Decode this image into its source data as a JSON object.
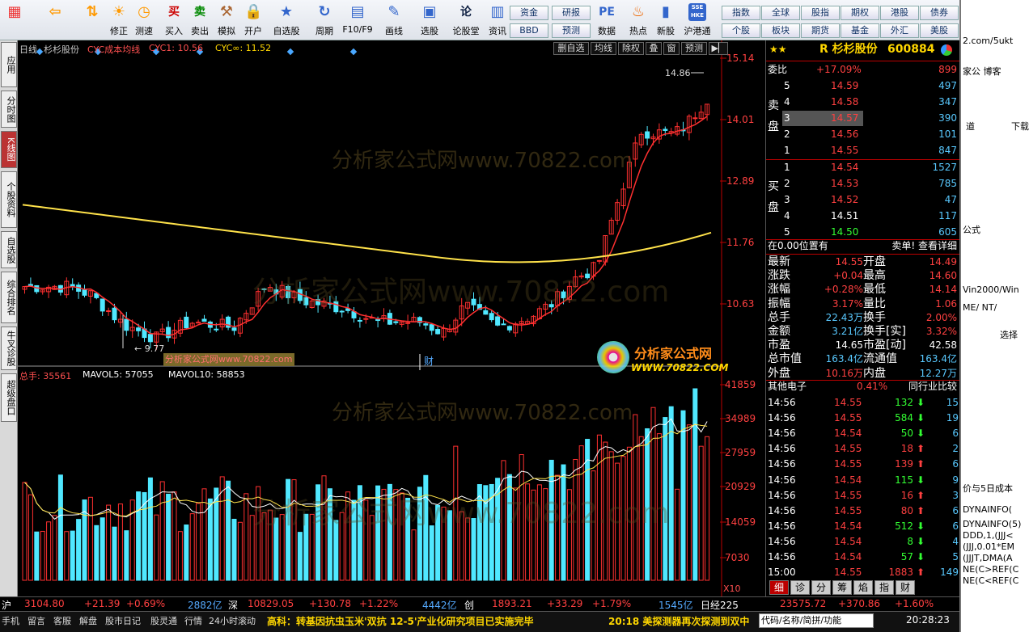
{
  "toolbar": {
    "buttons": [
      {
        "label": "",
        "icon": "grid-icon"
      },
      {
        "label": "",
        "icon": "back-arrow-icon"
      },
      {
        "label": "",
        "icon": "up-down-icon"
      },
      {
        "label": "修正",
        "icon": "sun-icon"
      },
      {
        "label": "测速",
        "icon": "clock-icon"
      },
      {
        "label": "买入",
        "icon": "buy-icon",
        "glyph": "买"
      },
      {
        "label": "卖出",
        "icon": "sell-icon",
        "glyph": "卖"
      },
      {
        "label": "模拟",
        "icon": "hammer-icon"
      },
      {
        "label": "开户",
        "icon": "lock-icon"
      },
      {
        "label": "自选股",
        "icon": "star-icon"
      },
      {
        "label": "周期",
        "icon": "cycle-icon"
      },
      {
        "label": "F10/F9",
        "icon": "f10-icon"
      },
      {
        "label": "画线",
        "icon": "pen-icon"
      },
      {
        "label": "选股",
        "icon": "monitor-icon"
      },
      {
        "label": "论股堂",
        "icon": "lun-icon",
        "glyph": "论"
      },
      {
        "label": "资讯",
        "icon": "news-icon"
      },
      {
        "label": "数据",
        "icon": "pe-icon",
        "glyph": "PE"
      },
      {
        "label": "热点",
        "icon": "fire-icon"
      },
      {
        "label": "新股",
        "icon": "newstock-icon"
      },
      {
        "label": "沪港通",
        "icon": "hkex-icon",
        "glyph": "SSE HKE"
      }
    ],
    "tags1": [
      "资金",
      "研报"
    ],
    "tags2": [
      "BBD",
      "预测"
    ],
    "tags3": [
      "指数",
      "全球",
      "股指",
      "期权",
      "港股",
      "债券"
    ],
    "tags4": [
      "个股",
      "板块",
      "期货",
      "基金",
      "外汇",
      "美股"
    ]
  },
  "left_tabs": [
    "应用",
    "分时图",
    "K线图",
    "个股资料",
    "自选股",
    "综合排名",
    "牛叉诊股",
    "超级盘口"
  ],
  "chart": {
    "header": {
      "period": "日线",
      "name": "杉杉股份",
      "indicator": "CYC成本均线",
      "cyc1": "CYC1: 10.56",
      "cycinf": "CYC∞: 11.52"
    },
    "buttons": [
      "删自选",
      "均线",
      "除权",
      "叠",
      "窗",
      "预测"
    ],
    "yticks": [
      "15.14",
      "14.01",
      "12.89",
      "11.76",
      "10.63"
    ],
    "high_label": "14.86",
    "low_label": "9.77",
    "watermark_small": "分析家公式网www.70822.com",
    "watermark_big": "分析家公式网www.70822.com",
    "cai": "财",
    "vol_header": {
      "total": "总手: 35561",
      "mavol5": "MAVOL5: 57055",
      "mavol10": "MAVOL10: 58853"
    },
    "vol_ticks": [
      "41859",
      "34989",
      "27959",
      "20929",
      "14059",
      "7030"
    ],
    "x10": "X10",
    "logo_text": "分析家公式网",
    "logo_url": "WWW.70822.COM"
  },
  "quote": {
    "stars": "★★",
    "title": "R 杉杉股份",
    "code": "600884",
    "weibi": {
      "label": "委比",
      "pct": "+17.09%",
      "diff": "899"
    },
    "sell_side": "卖盘",
    "buy_side": "买盘",
    "sell": [
      {
        "n": "5",
        "p": "14.59",
        "v": "497"
      },
      {
        "n": "4",
        "p": "14.58",
        "v": "347"
      },
      {
        "n": "3",
        "p": "14.57",
        "v": "390"
      },
      {
        "n": "2",
        "p": "14.56",
        "v": "101"
      },
      {
        "n": "1",
        "p": "14.55",
        "v": "847"
      }
    ],
    "buy": [
      {
        "n": "1",
        "p": "14.54",
        "v": "1527"
      },
      {
        "n": "2",
        "p": "14.53",
        "v": "785"
      },
      {
        "n": "3",
        "p": "14.52",
        "v": "47"
      },
      {
        "n": "4",
        "p": "14.51",
        "v": "117"
      },
      {
        "n": "5",
        "p": "14.50",
        "v": "605"
      }
    ],
    "pos": "在0.00位置有",
    "detail": "卖单! 查看详细",
    "stats": [
      [
        "最新",
        "14.55",
        "开盘",
        "14.49"
      ],
      [
        "涨跌",
        "+0.04",
        "最高",
        "14.60"
      ],
      [
        "涨幅",
        "+0.28%",
        "最低",
        "14.14"
      ],
      [
        "振幅",
        "3.17%",
        "量比",
        "1.06"
      ],
      [
        "总手",
        "22.43万",
        "换手",
        "2.00%"
      ],
      [
        "金额",
        "3.21亿",
        "换手[实]",
        "3.32%"
      ],
      [
        "市盈",
        "14.65",
        "市盈[动]",
        "42.58"
      ],
      [
        "总市值",
        "163.4亿",
        "流通值",
        "163.4亿"
      ],
      [
        "外盘",
        "10.16万",
        "内盘",
        "12.27万"
      ]
    ],
    "industry": {
      "name": "其他电子",
      "pct": "0.41%",
      "compare": "同行业比较"
    },
    "ticks": [
      [
        "14:56",
        "14.55",
        "132",
        "15",
        "down"
      ],
      [
        "14:56",
        "14.55",
        "584",
        "19",
        "down"
      ],
      [
        "14:56",
        "14.54",
        "50",
        "6",
        "down"
      ],
      [
        "14:56",
        "14.55",
        "18",
        "2",
        "up"
      ],
      [
        "14:56",
        "14.55",
        "139",
        "6",
        "up"
      ],
      [
        "14:56",
        "14.54",
        "115",
        "9",
        "down"
      ],
      [
        "14:56",
        "14.55",
        "16",
        "3",
        "up"
      ],
      [
        "14:56",
        "14.55",
        "80",
        "6",
        "up"
      ],
      [
        "14:56",
        "14.54",
        "512",
        "6",
        "down"
      ],
      [
        "14:56",
        "14.54",
        "8",
        "4",
        "down"
      ],
      [
        "14:56",
        "14.54",
        "57",
        "5",
        "down"
      ],
      [
        "15:00",
        "14.55",
        "1883",
        "149",
        "up"
      ]
    ],
    "tabs": [
      "细",
      "诊",
      "分",
      "筹",
      "焰",
      "指",
      "财"
    ]
  },
  "status": {
    "sh": "沪",
    "sh_idx": "3104.80",
    "sh_chg": "+21.39",
    "sh_pct": "+0.69%",
    "sh_amt": "2882亿",
    "sz": "深",
    "sz_idx": "10829.05",
    "sz_chg": "+130.78",
    "sz_pct": "+1.22%",
    "sz_amt": "4442亿",
    "cy": "创",
    "cy_idx": "1893.21",
    "cy_chg": "+33.29",
    "cy_pct": "+1.79%",
    "cy_amt": "1545亿",
    "rj": "日经225",
    "rj_idx": "23575.72",
    "rj_chg": "+370.86",
    "rj_pct": "+1.60%"
  },
  "bottom": {
    "items": [
      "手机",
      "留言",
      "客服",
      "解盘",
      "股市日记",
      "股灵通",
      "行情",
      "24小时滚动"
    ],
    "news1": "高科：转基因抗虫玉米'双抗 12-5'产业化研究项目已实施完毕",
    "news2": "20:18 美探测器再次探测到双中",
    "search": "代码/名称/简拼/功能",
    "time": "20:28:23"
  },
  "right_strip": {
    "lines": [
      "2.com/5ukt",
      "家公 博客",
      "道",
      "下载",
      "公式",
      "Vin2000/Win",
      "ME/ NT/",
      "选择",
      "价与5日成本",
      "DYNAINFO(",
      "DYNAINFO(5)",
      "DDD,1,(JJJ<",
      "(JJJ,0.01*EM",
      "(JJJT,DMA(A",
      "NE(C>REF(C",
      "NE(C<REF(C"
    ]
  }
}
